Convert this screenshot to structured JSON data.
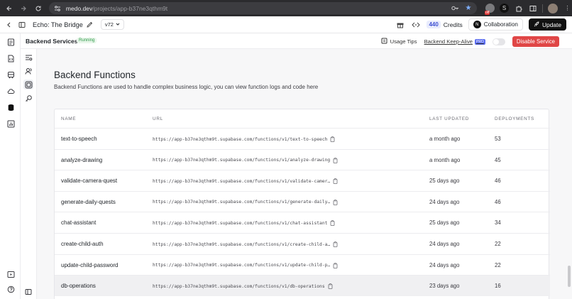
{
  "browser": {
    "url_host": "medo.dev",
    "url_path": "/projects/app-b37ne3qthm9t",
    "ext_badge": "off"
  },
  "header": {
    "project_title": "Echo: The Bridge",
    "version": "v72",
    "credits_value": "440",
    "credits_label": "Credits",
    "collaboration_label": "Collaboration",
    "collab_initial": "N",
    "update_label": "Update"
  },
  "subheader": {
    "title": "Backend Services",
    "status": "Running",
    "usage_tips": "Usage Tips",
    "keep_alive": "Backend Keep-Alive",
    "pro": "PRO",
    "disable_label": "Disable Service"
  },
  "page": {
    "title": "Backend Functions",
    "description": "Backend Functions are used to handle complex business logic, you can view function logs and code here"
  },
  "table": {
    "columns": [
      "NAME",
      "URL",
      "LAST UPDATED",
      "DEPLOYMENTS"
    ],
    "rows": [
      {
        "name": "text-to-speech",
        "url": "https://app-b37ne3qthm9t.supabase.com/functions/v1/text-to-speech",
        "updated": "a month ago",
        "deployments": "53"
      },
      {
        "name": "analyze-drawing",
        "url": "https://app-b37ne3qthm9t.supabase.com/functions/v1/analyze-drawing",
        "updated": "a month ago",
        "deployments": "45"
      },
      {
        "name": "validate-camera-quest",
        "url": "https://app-b37ne3qthm9t.supabase.com/functions/v1/validate-camer…",
        "updated": "25 days ago",
        "deployments": "46"
      },
      {
        "name": "generate-daily-quests",
        "url": "https://app-b37ne3qthm9t.supabase.com/functions/v1/generate-daily…",
        "updated": "24 days ago",
        "deployments": "46"
      },
      {
        "name": "chat-assistant",
        "url": "https://app-b37ne3qthm9t.supabase.com/functions/v1/chat-assistant",
        "updated": "25 days ago",
        "deployments": "34"
      },
      {
        "name": "create-child-auth",
        "url": "https://app-b37ne3qthm9t.supabase.com/functions/v1/create-child-a…",
        "updated": "24 days ago",
        "deployments": "22"
      },
      {
        "name": "update-child-password",
        "url": "https://app-b37ne3qthm9t.supabase.com/functions/v1/update-child-p…",
        "updated": "24 days ago",
        "deployments": "22"
      },
      {
        "name": "db-operations",
        "url": "https://app-b37ne3qthm9t.supabase.com/functions/v1/db-operations",
        "updated": "23 days ago",
        "deployments": "16"
      }
    ]
  },
  "colors": {
    "accent": "#3d4fd1",
    "danger": "#e04646",
    "running": "#2f9a4a"
  }
}
